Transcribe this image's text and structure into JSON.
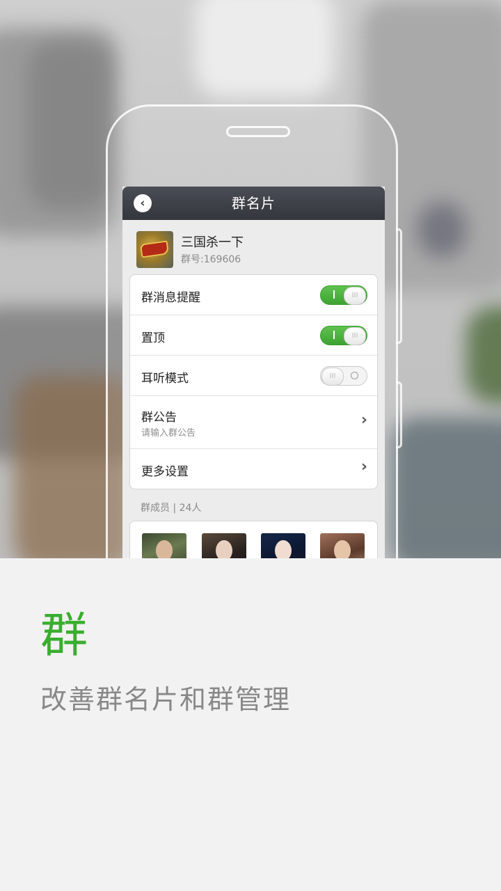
{
  "app": {
    "title": "群名片",
    "group": {
      "name": "三国杀一下",
      "id_text": "群号:169606"
    },
    "settings": [
      {
        "label": "群消息提醒",
        "control": "toggle",
        "on": true
      },
      {
        "label": "置顶",
        "control": "toggle",
        "on": true
      },
      {
        "label": "耳听模式",
        "control": "toggle",
        "on": false
      },
      {
        "label": "群公告",
        "sublabel": "请输入群公告",
        "control": "chevron"
      },
      {
        "label": "更多设置",
        "control": "chevron"
      }
    ],
    "chevron_glyph": "›",
    "members_header": "群成员 | 24人",
    "accent_color": "#3aad2f"
  },
  "caption": {
    "title": "群",
    "subtitle": "改善群名片和群管理"
  }
}
